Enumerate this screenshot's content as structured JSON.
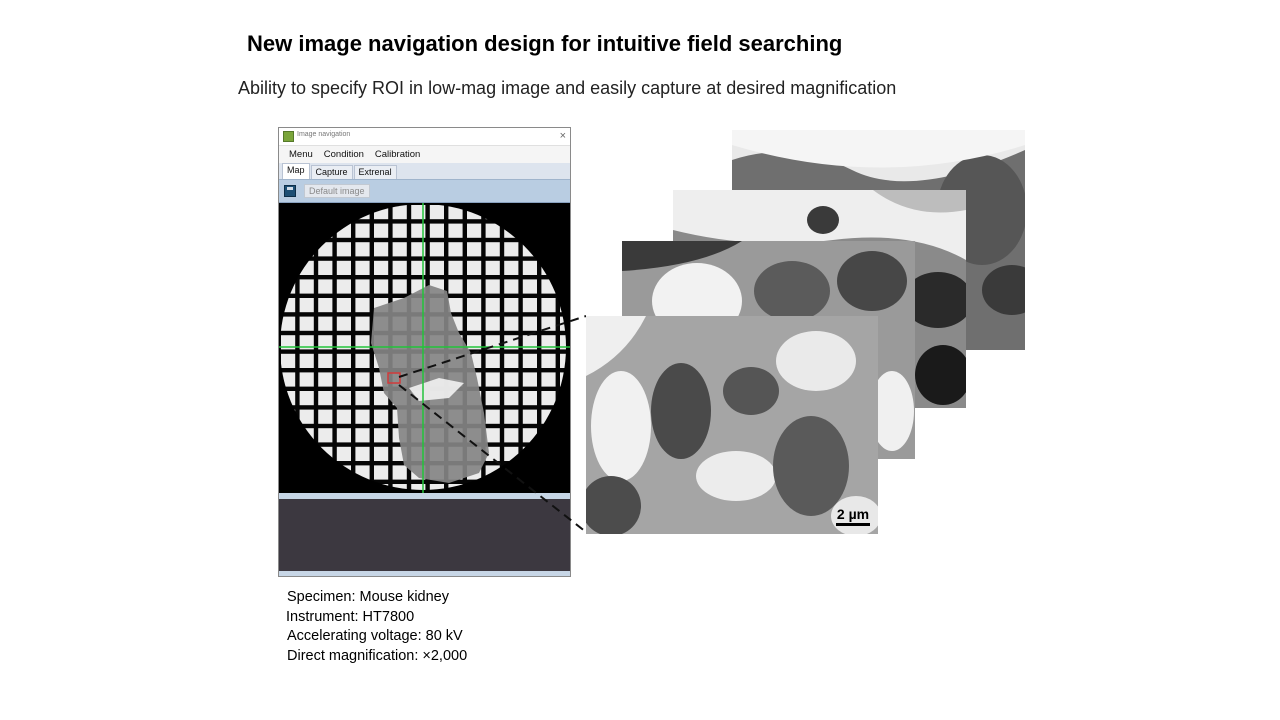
{
  "slide": {
    "title": "New image navigation design for intuitive field searching",
    "subtitle": "Ability to specify ROI in low-mag image and easily capture at desired magnification"
  },
  "window": {
    "title": "Image navigation",
    "close_glyph": "×",
    "menu": [
      "Menu",
      "Condition",
      "Calibration"
    ],
    "tabs": [
      "Map",
      "Capture",
      "Extrenal"
    ],
    "active_tab": "Map",
    "toolbar": {
      "default_image_label": "Default image"
    }
  },
  "micrograph": {
    "scale_bar": "2 µm"
  },
  "specs": [
    "Specimen: Mouse kidney",
    "Instrument:  HT7800",
    "Accelerating voltage: 80 kV",
    "Direct magnification: ×2,000"
  ],
  "colors": {
    "crosshair": "#22c33a",
    "roi": "#d23a3a",
    "toolbar": "#b9cde2"
  }
}
